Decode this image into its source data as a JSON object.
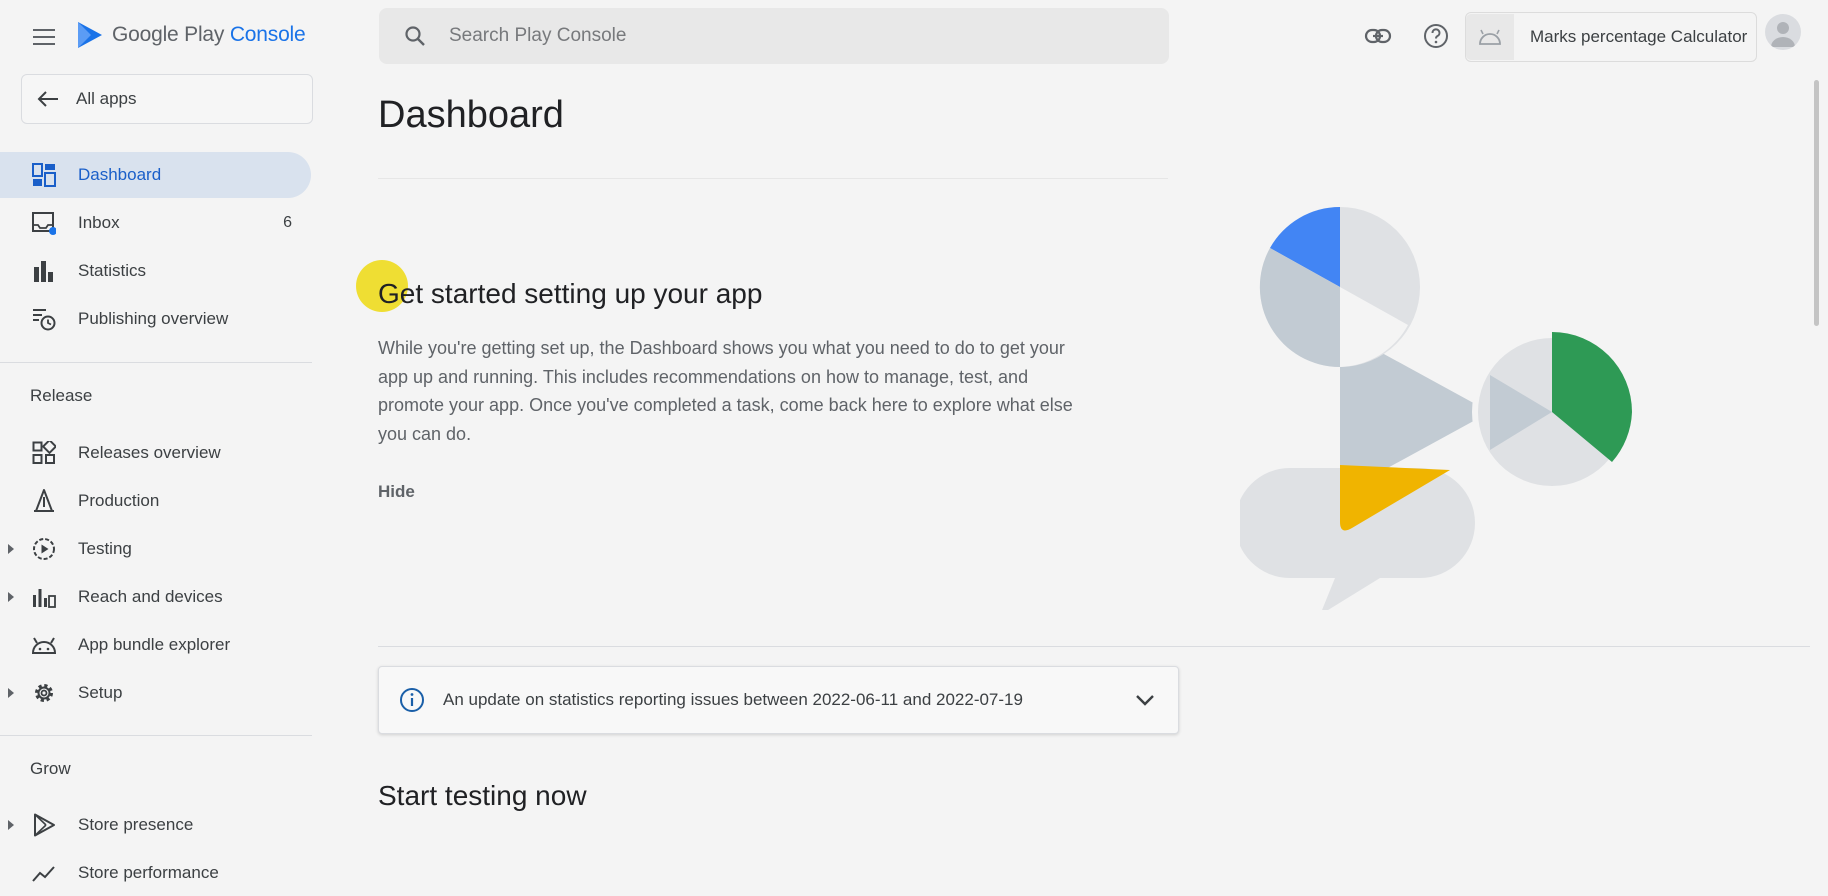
{
  "header": {
    "logo_text_main": "Google Play",
    "logo_text_accent": "Console",
    "search_placeholder": "Search Play Console",
    "app_name": "Marks percentage Calculator",
    "icons": [
      "menu-icon",
      "link-icon",
      "help-icon",
      "android-icon",
      "account-avatar"
    ]
  },
  "sidebar": {
    "all_apps_label": "All apps",
    "items": [
      {
        "label": "Dashboard",
        "icon": "dashboard-icon",
        "active": true
      },
      {
        "label": "Inbox",
        "icon": "inbox-icon",
        "badge": "6"
      },
      {
        "label": "Statistics",
        "icon": "bar-chart-icon"
      },
      {
        "label": "Publishing overview",
        "icon": "publishing-icon"
      }
    ],
    "release_label": "Release",
    "release_items": [
      {
        "label": "Releases overview",
        "icon": "releases-overview-icon"
      },
      {
        "label": "Production",
        "icon": "production-icon"
      },
      {
        "label": "Testing",
        "icon": "testing-icon",
        "expandable": true
      },
      {
        "label": "Reach and devices",
        "icon": "reach-devices-icon",
        "expandable": true
      },
      {
        "label": "App bundle explorer",
        "icon": "android-bundle-icon"
      },
      {
        "label": "Setup",
        "icon": "gear-icon",
        "expandable": true
      }
    ],
    "grow_label": "Grow",
    "grow_items": [
      {
        "label": "Store presence",
        "icon": "play-outline-icon",
        "expandable": true
      },
      {
        "label": "Store performance",
        "icon": "trend-icon"
      }
    ]
  },
  "main": {
    "title": "Dashboard",
    "get_started": {
      "heading": "Get started setting up your app",
      "description": "While you're getting set up, the Dashboard shows you what you need to do to get your app up and running. This includes recommendations on how to manage, test, and promote your app. Once you've completed a task, come back here to explore what else you can do.",
      "hide_label": "Hide"
    },
    "notice_text": "An update on statistics reporting issues between 2022-06-11 and 2022-07-19",
    "section2_heading": "Start testing now"
  },
  "colors": {
    "accent": "#1a73e8",
    "active_nav_bg": "#d9e2ee",
    "illus_blue": "#4285f4",
    "illus_green": "#2e9a55",
    "illus_yellow": "#f0b400",
    "illus_gray": "#c2cbd3",
    "illus_light": "#dfe1e4"
  }
}
